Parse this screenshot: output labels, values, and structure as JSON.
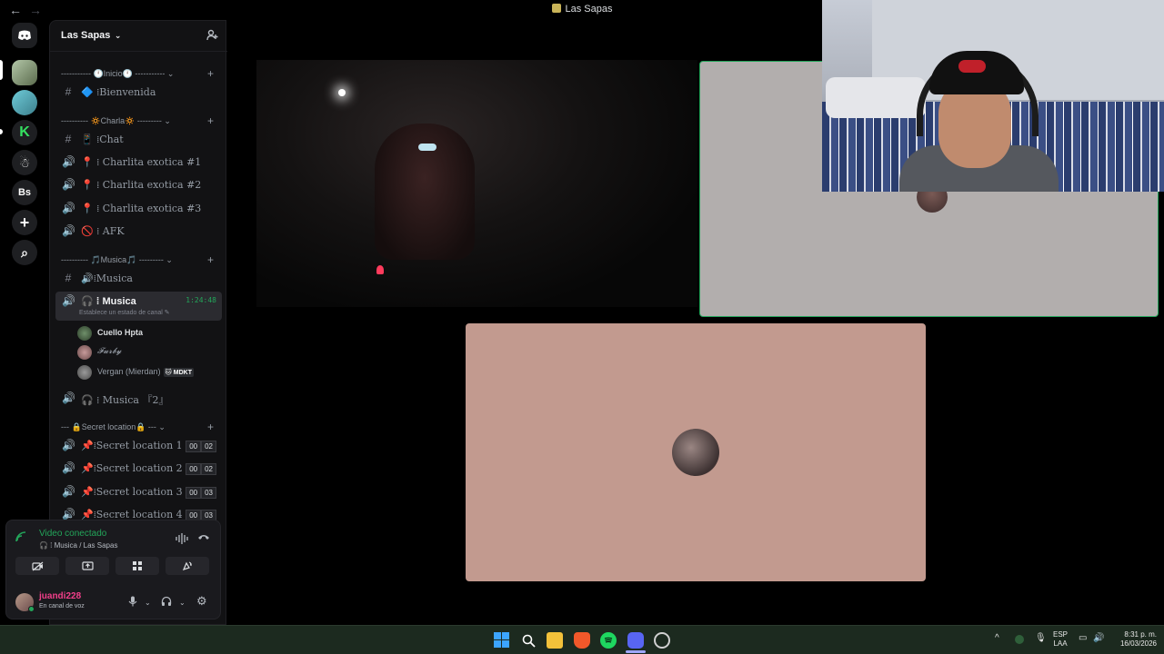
{
  "window": {
    "title": "Las Sapas",
    "back_label": "←",
    "forward_label": "→"
  },
  "server_rail": {
    "bs_label": "Bs",
    "add_label": "+",
    "explore_label": "⌕"
  },
  "sidebar": {
    "guild_name": "Las Sapas",
    "categories": [
      {
        "label": "----------- 🕛Inicio🕛 ----------- ⌄"
      },
      {
        "label": "---------- 🔅Charla🔅 --------- ⌄"
      },
      {
        "label": "---------- 🎵Musica🎵 --------- ⌄"
      },
      {
        "label": "--- 🔒Secret location🔒 --- ⌄"
      }
    ],
    "channels": [
      {
        "icon": "#",
        "name": "🔷 ⁞Bienvenida"
      },
      {
        "icon": "#",
        "name": "📱 ⁞Chat"
      },
      {
        "icon": "🔊",
        "name": "📍 ⁞ Charlita exotica #1"
      },
      {
        "icon": "🔊",
        "name": "📍 ⁞ Charlita exotica #2"
      },
      {
        "icon": "🔊",
        "name": "📍 ⁞ Charlita exotica #3"
      },
      {
        "icon": "🔊",
        "name": "🚫 ⁞ AFK"
      },
      {
        "icon": "#",
        "name": "🔊⁞Musica"
      },
      {
        "icon": "🔊",
        "name": "🎧 ⁞ Musica",
        "timer": "1:24:48",
        "status": "Establece un estado de canal ✎"
      },
      {
        "icon": "🔊",
        "name": "🎧 ⁞ Musica 『2』"
      },
      {
        "icon": "🔊",
        "name": "📌⁞Secret location 1",
        "badge_a": "00",
        "badge_b": "02"
      },
      {
        "icon": "🔊",
        "name": "📌⁞Secret location 2",
        "badge_a": "00",
        "badge_b": "02"
      },
      {
        "icon": "🔊",
        "name": "📌⁞Secret location 3",
        "badge_a": "00",
        "badge_b": "03"
      },
      {
        "icon": "🔊",
        "name": "📌⁞Secret location 4",
        "badge_a": "00",
        "badge_b": "03"
      }
    ],
    "voice_users": [
      {
        "name": "Cuello Hpta"
      },
      {
        "name": "𝓕𝓾𝓻𝓫𝔂"
      },
      {
        "name": "Vergan (Mierdan)",
        "tag": "🐱 MDKT"
      }
    ]
  },
  "voice_panel": {
    "title": "Video conectado",
    "subtitle": "🎧 ⁞ Musica / Las Sapas",
    "username": "juandi228",
    "user_status": "En canal de voz"
  },
  "taskbar": {
    "lang_top": "ESP",
    "lang_bottom": "LAA",
    "time": "8:31 p. m.",
    "date": "16/03/2026",
    "chevron": "^"
  },
  "colors": {
    "accent_green": "#23a55a",
    "username_pink": "#f23f8a",
    "tile_pink": "#c29a8f",
    "tile_grey": "#b2aead"
  }
}
